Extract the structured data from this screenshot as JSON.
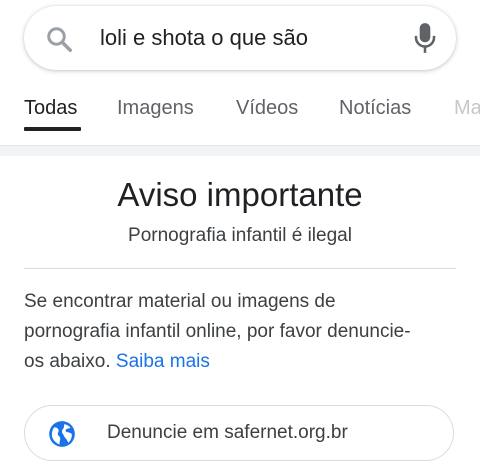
{
  "search": {
    "query": "loli e shota o que são"
  },
  "tabs": [
    {
      "label": "Todas"
    },
    {
      "label": "Imagens"
    },
    {
      "label": "Vídeos"
    },
    {
      "label": "Notícias"
    },
    {
      "label": "Ma"
    }
  ],
  "warning": {
    "title": "Aviso importante",
    "subtitle": "Pornografia infantil é ilegal",
    "body_lines": [
      "Se encontrar material ou imagens de",
      "pornografia infantil online, por favor denuncie-",
      "os abaixo. "
    ],
    "learn_more": "Saiba mais",
    "report_button": "Denuncie em safernet.org.br"
  },
  "icons": {
    "search": "search-icon",
    "mic": "microphone-icon",
    "globe": "globe-icon"
  },
  "colors": {
    "link": "#1a73e8",
    "globe_icon": "#1a73e8",
    "mic_icon": "#5f6368",
    "search_icon": "#9aa0a6",
    "active_tab": "#202124",
    "inactive_tab": "#5f6368"
  }
}
